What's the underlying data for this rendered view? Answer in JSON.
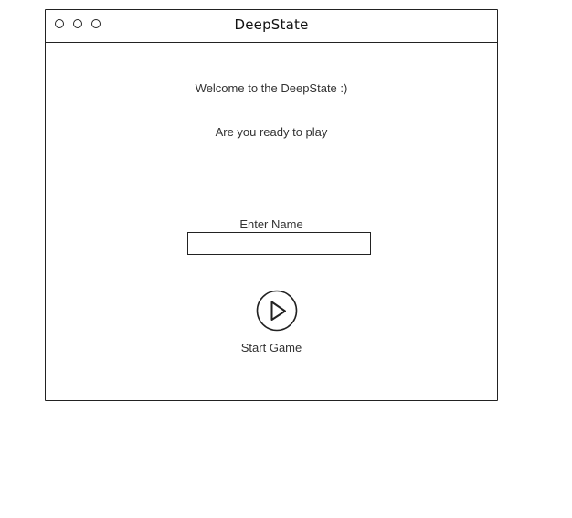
{
  "window": {
    "title": "DeepState",
    "controls": [
      "circle-icon",
      "circle-icon",
      "circle-icon"
    ]
  },
  "main": {
    "welcome_text": "Welcome to the DeepState :)",
    "prompt_text": "Are you ready to play",
    "name_label": "Enter Name",
    "name_value": "",
    "start_label": "Start Game",
    "start_icon": "play-icon"
  }
}
